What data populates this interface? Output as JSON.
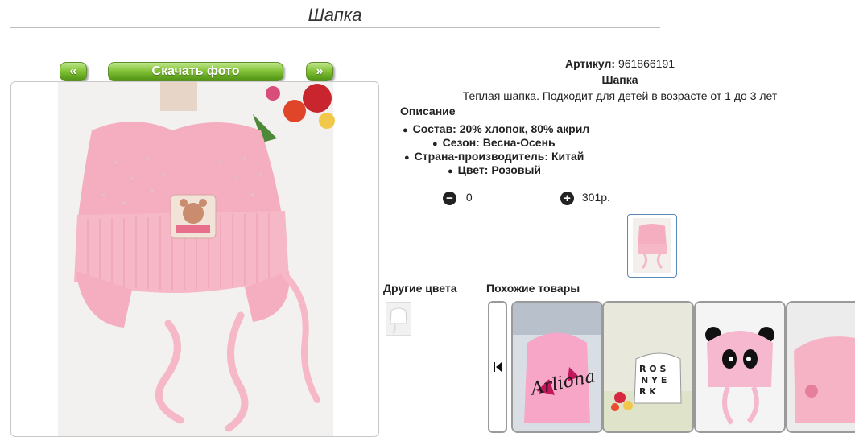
{
  "page": {
    "title": "Шапка"
  },
  "buttons": {
    "prev": "«",
    "download": "Скачать фото",
    "next": "»"
  },
  "product": {
    "sku_label": "Артикул:",
    "sku_value": "961866191",
    "name": "Шапка",
    "description": "Теплая шапка. Подходит для детей в возрасте от 1 до 3 лет",
    "description_heading": "Описание",
    "features": [
      "Состав: 20% хлопок, 80% акрил",
      "Сезон: Весна-Осень",
      "Страна-производитель: Китай",
      "Цвет: Розовый"
    ]
  },
  "cart": {
    "quantity": "0",
    "price": "301р."
  },
  "sections": {
    "other_colors": "Другие цвета",
    "similar": "Похожие товары"
  },
  "similar_items": [
    {
      "caption": "Arliona",
      "colors": {
        "bg": "#d9dde4",
        "hat": "#f7a6c8",
        "accent": "#c2185b"
      }
    },
    {
      "caption": "",
      "colors": {
        "bg": "#e8e8dc",
        "hat": "#ffffff",
        "accent": "#222222"
      }
    },
    {
      "caption": "",
      "colors": {
        "bg": "#f4f4f4",
        "hat": "#f6b8cf",
        "accent": "#111111"
      }
    },
    {
      "caption": "",
      "colors": {
        "bg": "#ececec",
        "hat": "#f7b3c6",
        "accent": "#e57f9c"
      }
    }
  ],
  "colors": {
    "accent_green": "#6aab27",
    "hat_pink": "#f4aebf",
    "link_blue": "#5b87b5"
  }
}
